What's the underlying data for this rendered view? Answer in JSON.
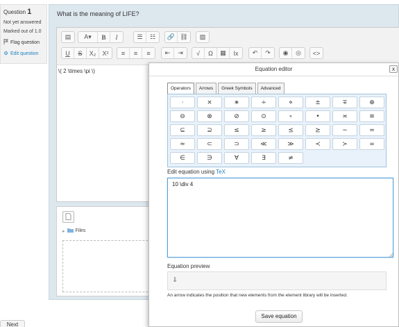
{
  "question": {
    "label": "Question",
    "number": "1",
    "status": "Not yet answered",
    "marked_out_of": "Marked out of 1.0",
    "flag": "Flag question",
    "edit": "Edit question",
    "text": "What is the meaning of LIFE?"
  },
  "editor": {
    "toolbar_row1": [
      "paragraph-style-icon",
      "font-style-dropdown",
      "B",
      "I",
      "unordered-list-icon",
      "ordered-list-icon",
      "link-icon",
      "unlink-icon",
      "image-icon"
    ],
    "toolbar_row2": [
      "U",
      "S",
      "X₂",
      "X²",
      "align-left-icon",
      "align-center-icon",
      "align-right-icon",
      "outdent-icon",
      "indent-icon",
      "√",
      "Ω",
      "table-icon",
      "clear-format-icon",
      "undo-icon",
      "redo-icon",
      "accessibility-icon",
      "screenreader-icon",
      "html-icon"
    ],
    "content": "\\( 2 \\times \\pi \\)"
  },
  "filepicker": {
    "files_label": "Files"
  },
  "next_button": "Next",
  "dialog": {
    "title": "Equation editor",
    "close": "x",
    "tabs": [
      "Operators",
      "Arrows",
      "Greek Symbols",
      "Advanced"
    ],
    "active_tab": "Operators",
    "symbols": [
      "·",
      "×",
      "∗",
      "÷",
      "⋄",
      "±",
      "∓",
      "⊕",
      "⊖",
      "⊗",
      "⊘",
      "⊙",
      "∘",
      "•",
      "≍",
      "≡",
      "⊆",
      "⊇",
      "≤",
      "≥",
      "⪯",
      "⪰",
      "∼",
      "≃",
      "≈",
      "⊂",
      "⊃",
      "≪",
      "≫",
      "≺",
      "≻",
      "∞",
      "∈",
      "∋",
      "∀",
      "∃",
      "≠"
    ],
    "edit_label": "Edit equation using",
    "tex_link": "TeX",
    "tex_value": "10 \\div 4",
    "preview_label": "Equation preview",
    "preview_arrow": "⇓",
    "hint": "An arrow indicates the position that new elements from the element library will be inserted.",
    "save_label": "Save equation"
  }
}
